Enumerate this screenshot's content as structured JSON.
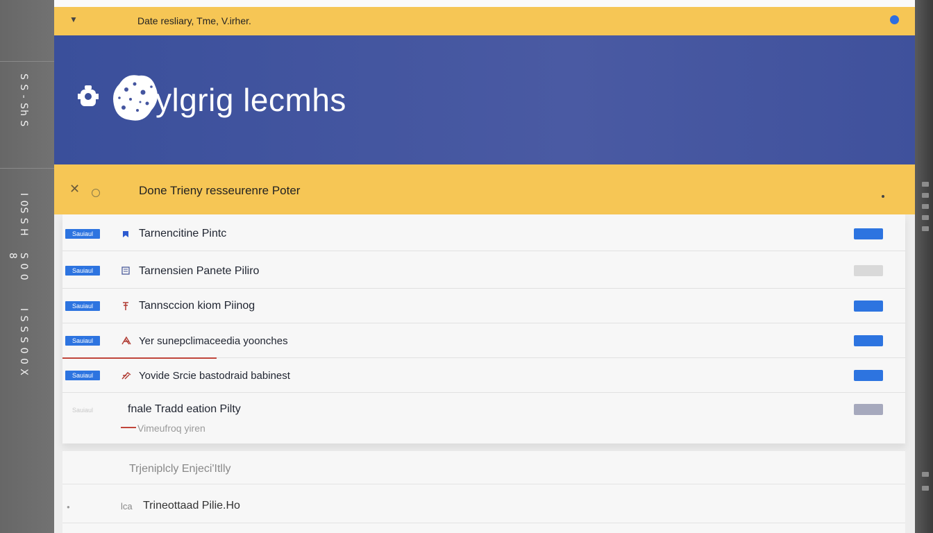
{
  "topbar": {
    "breadcrumb": "Date resliary,  Tme,  V.irher."
  },
  "hero": {
    "title": "ylgrig lecmhs"
  },
  "subbar": {
    "title": "Done Trieny  resseurenre Poter"
  },
  "left_rail": {
    "labels": [
      "S S - Sh S",
      "I 0S S H",
      "S 0 0 8",
      "I S S S 0 0 X"
    ]
  },
  "list": {
    "rows": [
      {
        "tag": "Sauiaul",
        "icon": "bookmark-icon",
        "label": "Tarnencitine Pintc",
        "switch": "on"
      },
      {
        "tag": "Sauiaul",
        "icon": "document-icon",
        "label": "Tarnensien Panete Piliro",
        "switch": "off"
      },
      {
        "tag": "Sauiaul",
        "icon": "pin-icon",
        "label": "Tannsccion kiom Piinog",
        "switch": "on"
      },
      {
        "tag": "Sauiaul",
        "icon": "brand-icon",
        "label": "Yer sunepclimaceedia yoonches",
        "switch": "on"
      },
      {
        "tag": "Sauiaul",
        "icon": "brand-icon",
        "label": "Yovide Srcie bastodraid babinest",
        "switch": "on"
      },
      {
        "tag": "Sauiaul",
        "icon": "",
        "label": "fnale  Tradd eation Pilty",
        "sublabel": "Vimeufroq yiren",
        "switch": "disabled"
      }
    ]
  },
  "lower": {
    "rows": [
      {
        "label": "Trjeniplcly Enjeci'Itlly"
      },
      {
        "label": "Trineottaad Pilie.Ho",
        "prefix": "lca"
      }
    ]
  },
  "colors": {
    "accent_yellow": "#f6c655",
    "hero_blue": "#44559f",
    "switch_on": "#2d74e0",
    "switch_off": "#d9d9d9",
    "switch_disabled": "#a6a9bd",
    "alert_red": "#c0453b"
  }
}
